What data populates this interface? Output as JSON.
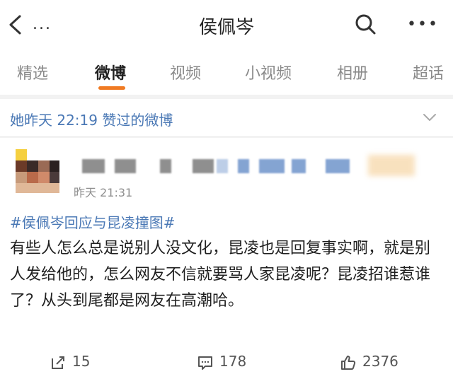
{
  "header": {
    "back_icon": "chevron-left-icon",
    "more_left": "...",
    "title": "侯佩岑",
    "search_icon": "search-icon",
    "more_right": "•••"
  },
  "tabs": [
    {
      "label": "精选",
      "active": false
    },
    {
      "label": "微博",
      "active": true
    },
    {
      "label": "视频",
      "active": false
    },
    {
      "label": "小视频",
      "active": false
    },
    {
      "label": "相册",
      "active": false
    },
    {
      "label": "超话",
      "active": false
    }
  ],
  "liked": {
    "text": "她昨天 22:19 赞过的微博",
    "icon": "chevron-down-icon"
  },
  "post": {
    "time": "昨天 21:31",
    "hashtag": "#侯佩岑回应与昆凌撞图#",
    "content": "有些人怎么总是说别人没文化，昆凌也是回复事实啊，就是别人发给他的，怎么网友不信就要骂人家昆凌呢？昆凌招谁惹谁了？从头到尾都是网友在高潮哈。",
    "repost_count": "15",
    "comment_count": "178",
    "like_count": "2376"
  },
  "colors": {
    "accent": "#f07a22",
    "link": "#4a78b5"
  }
}
